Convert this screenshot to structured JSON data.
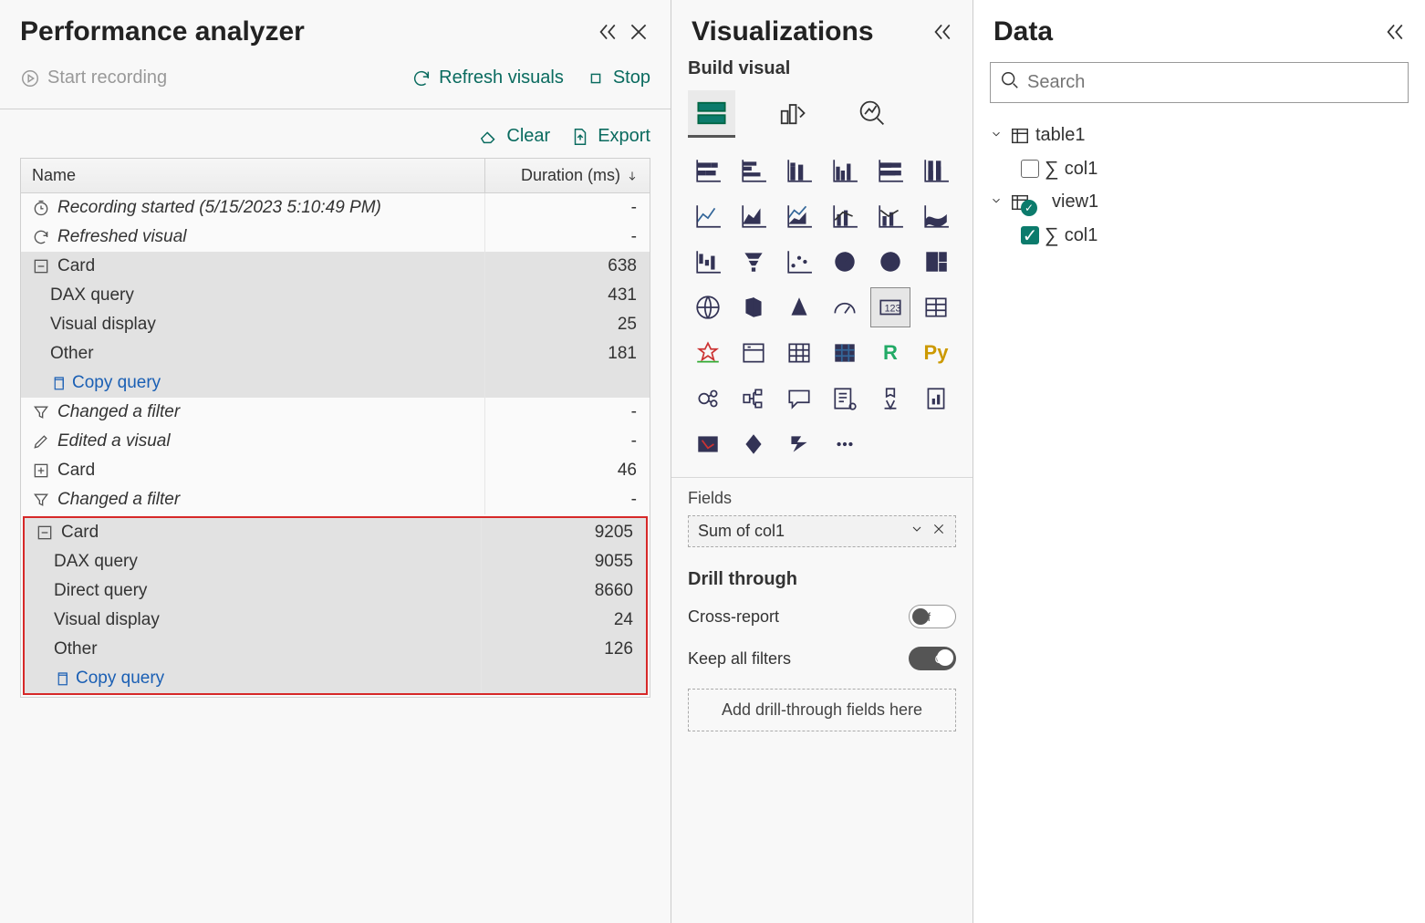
{
  "perf": {
    "title": "Performance analyzer",
    "start_recording": "Start recording",
    "refresh_visuals": "Refresh visuals",
    "stop": "Stop",
    "clear": "Clear",
    "export": "Export",
    "col_name": "Name",
    "col_duration": "Duration (ms)",
    "rows": {
      "rec_started": "Recording started (5/15/2023 5:10:49 PM)",
      "refreshed": "Refreshed visual",
      "card1": "Card",
      "card1_dur": "638",
      "dax1": "DAX query",
      "dax1_dur": "431",
      "vis1": "Visual display",
      "vis1_dur": "25",
      "oth1": "Other",
      "oth1_dur": "181",
      "copyq": "Copy query",
      "chfilter1": "Changed a filter",
      "edited": "Edited a visual",
      "card2": "Card",
      "card2_dur": "46",
      "chfilter2": "Changed a filter",
      "card3": "Card",
      "card3_dur": "9205",
      "dax3": "DAX query",
      "dax3_dur": "9055",
      "dq3": "Direct query",
      "dq3_dur": "8660",
      "vis3": "Visual display",
      "vis3_dur": "24",
      "oth3": "Other",
      "oth3_dur": "126"
    },
    "dash": "-"
  },
  "viz": {
    "title": "Visualizations",
    "build_visual": "Build visual",
    "fields_label": "Fields",
    "field_value": "Sum of col1",
    "drill_through": "Drill through",
    "cross_report": "Cross-report",
    "keep_filters": "Keep all filters",
    "off": "Off",
    "on": "On",
    "drill_placeholder": "Add drill-through fields here",
    "icons": [
      "stacked-bar",
      "clustered-bar",
      "stacked-col",
      "clustered-col",
      "100-bar",
      "100-col",
      "line",
      "area",
      "stacked-area",
      "line-col",
      "line-col2",
      "ribbon",
      "waterfall",
      "funnel",
      "scatter",
      "pie",
      "donut",
      "treemap",
      "map",
      "filled-map",
      "azure-map",
      "gauge",
      "card",
      "multi-row",
      "kpi",
      "slicer",
      "table",
      "matrix",
      "r",
      "py",
      "key-influencers",
      "decomp",
      "qa",
      "narrative",
      "goals",
      "paginated",
      "arcgis",
      "powerapps",
      "powerautomate",
      "more"
    ]
  },
  "data": {
    "title": "Data",
    "search_placeholder": "Search",
    "tree": {
      "t1": "table1",
      "t1c1": "col1",
      "v1": "view1",
      "v1c1": "col1"
    }
  }
}
